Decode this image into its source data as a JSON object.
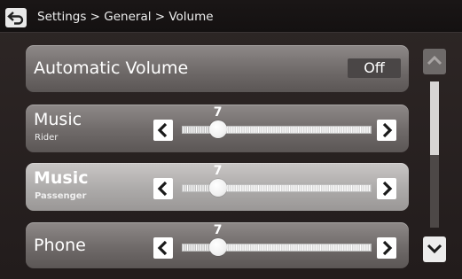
{
  "header": {
    "back_icon": "back-arrow-icon",
    "breadcrumb": "Settings > General > Volume"
  },
  "settings": [
    {
      "id": "automatic-volume",
      "title": "Automatic Volume",
      "value": "Off"
    },
    {
      "id": "music-rider",
      "title": "Music",
      "subtitle": "Rider",
      "level": "7",
      "level_fraction": 0.19,
      "selected": false
    },
    {
      "id": "music-passenger",
      "title": "Music",
      "subtitle": "Passenger",
      "level": "7",
      "level_fraction": 0.19,
      "selected": true
    },
    {
      "id": "phone",
      "title": "Phone",
      "level": "7",
      "level_fraction": 0.19,
      "selected": false
    }
  ],
  "controls": {
    "decrease_icon": "chevron-left-icon",
    "increase_icon": "chevron-right-icon"
  },
  "scrollbar": {
    "up_icon": "chevron-up-icon",
    "down_icon": "chevron-down-icon",
    "position_fraction": 0,
    "visible_fraction": 0.5
  },
  "colors": {
    "background": "#2e2726",
    "row": "#7a7574",
    "row_selected": "#b3b0af",
    "accent": "#ffffff"
  }
}
